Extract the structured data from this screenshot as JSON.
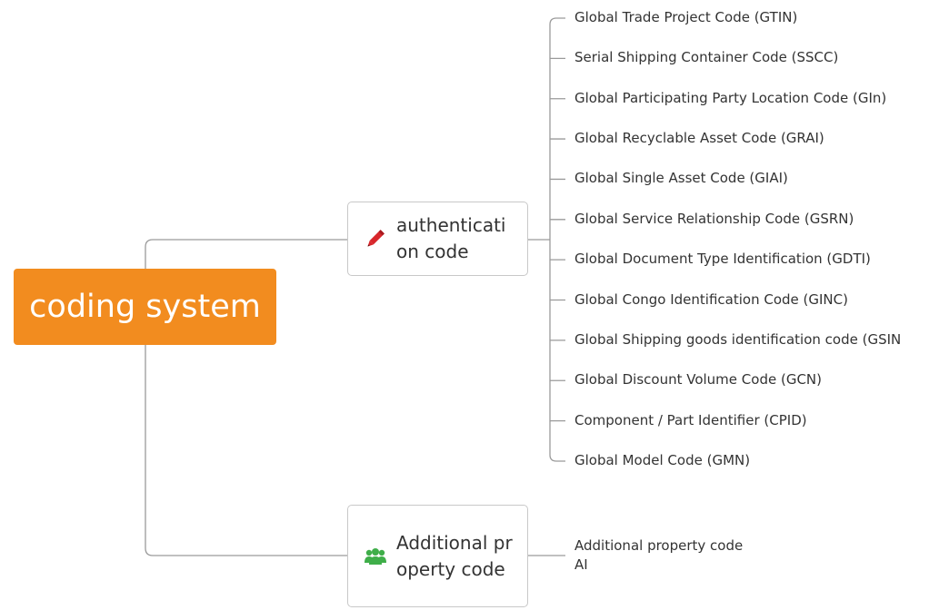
{
  "root": {
    "label": "coding system"
  },
  "nodes": {
    "authentication": {
      "label": "authentication code",
      "icon": "pencil-icon",
      "leaves": [
        "Global Trade Project Code (GTIN)",
        "Serial Shipping Container Code (SSCC)",
        "Global Participating Party Location Code (GIn)",
        "Global Recyclable Asset Code (GRAI)",
        "Global Single Asset Code (GIAI)",
        "Global Service Relationship Code (GSRN)",
        "Global Document Type Identification (GDTI)",
        "Global Congo Identification Code (GINC)",
        "Global Shipping goods identification code (GSIN",
        "Global Discount Volume Code (GCN)",
        "Component / Part Identifier (CPID)",
        "Global Model Code (GMN)"
      ]
    },
    "additional": {
      "label": "Additional property code",
      "icon": "people-icon",
      "leaves": [
        "Additional property code AI"
      ],
      "leaf_lines": [
        "Additional property code",
        "AI"
      ]
    }
  },
  "colors": {
    "root_fill": "#f28c1f",
    "connector": "#9a9a9a",
    "pencil": "#d8262b",
    "people": "#3fae49"
  }
}
